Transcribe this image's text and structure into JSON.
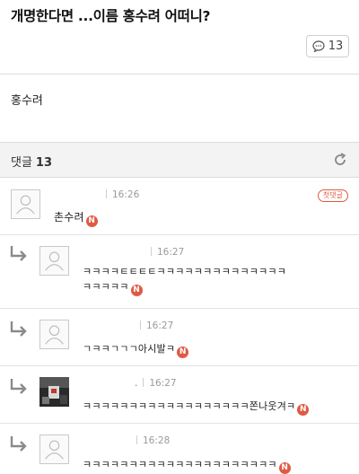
{
  "post": {
    "title": "개명한다면 ...이름 홍수려 어떠니?",
    "comment_count": "13",
    "body": "홍수려"
  },
  "comments_section": {
    "label": "댓글",
    "count": "13"
  },
  "comments": [
    {
      "time": "16:26",
      "lines": [
        "촌수려"
      ],
      "new_badge": "N",
      "best_badge": "첫댓글",
      "is_reply": false
    },
    {
      "time": "16:27",
      "lines": [
        "ㅋㅋㅋㅋㅌㅌㅌㅌㅋㅋㅋㅋㅋㅋㅋㅋㅋㅋㅋㅋㅋㅋ",
        "ㅋㅋㅋㅋㅋ"
      ],
      "new_badge": "N",
      "is_reply": true
    },
    {
      "time": "16:27",
      "lines": [
        "ㄱㅋㅋㄱㄱㄱ아시발ㅋ"
      ],
      "new_badge": "N",
      "is_reply": true
    },
    {
      "dot": ".",
      "time": "16:27",
      "lines": [
        "ㅋㅋㅋㅋㅋㅋㅋㅋㅋㅋㅋㅋㅋㅋㅋㅋㅋㅋ쫀나웃겨ㅋ"
      ],
      "new_badge": "N",
      "is_reply": true
    },
    {
      "time": "16:28",
      "lines": [
        "ㅋㅋㅋㅋㅋㅋㅋㅋㅋㅋㅋㅋㅋㅋㅋㅋㅋㅋㅋㅋㅋ"
      ],
      "new_badge": "N",
      "is_reply": true
    }
  ],
  "colors": {
    "new_badge": "#e05a43",
    "best_badge": "#e0593f",
    "section_bg": "#f3f3f3"
  },
  "icons": {
    "comment_button": "speech-bubble-icon",
    "refresh": "refresh-icon",
    "reply": "reply-arrow-icon",
    "avatar": "default-avatar-icon"
  }
}
